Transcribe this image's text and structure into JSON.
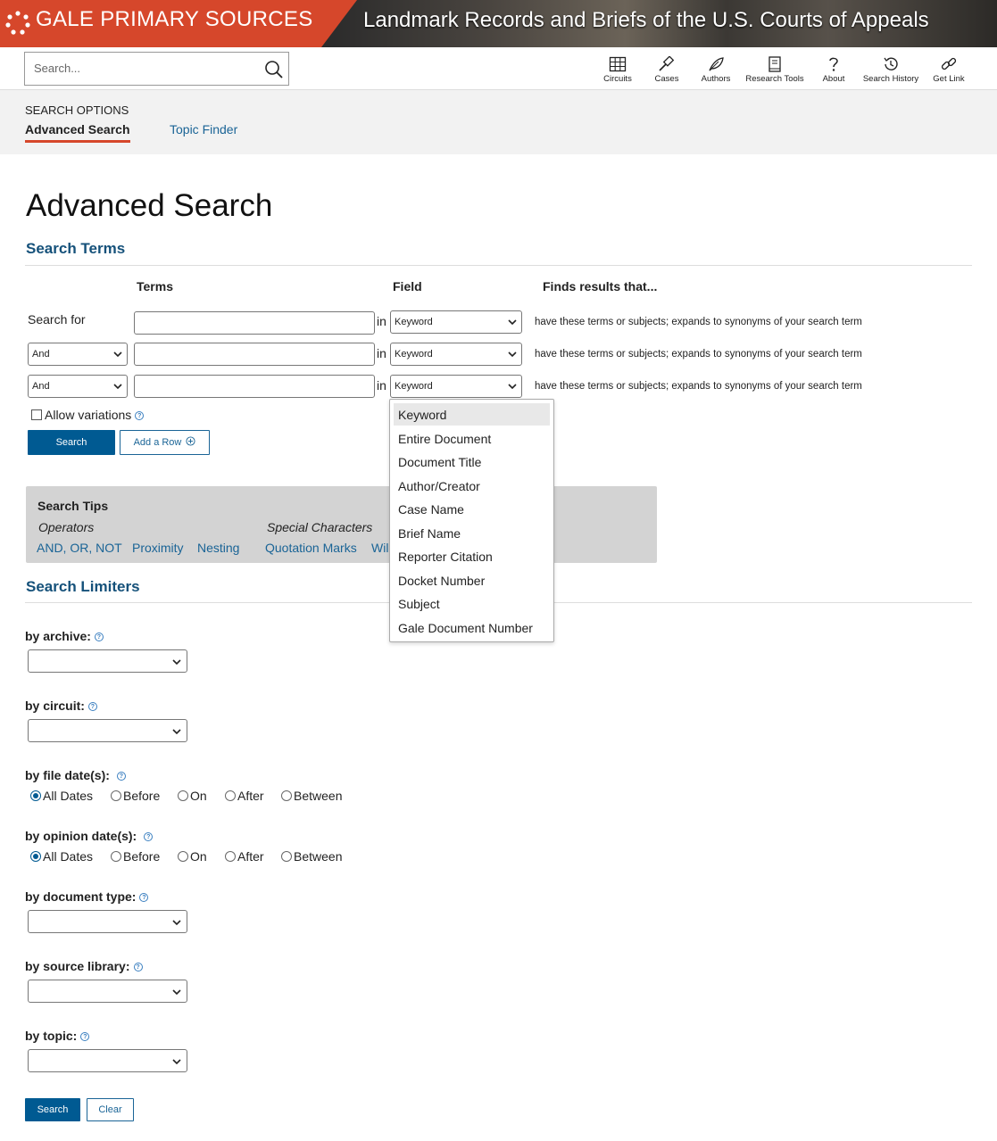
{
  "banner": {
    "brand": "GALE PRIMARY SOURCES",
    "collection": "Landmark Records and Briefs of the U.S. Courts of Appeals"
  },
  "toolbar": {
    "search_placeholder": "Search...",
    "tools": [
      {
        "label": "Circuits",
        "icon": "grid-icon"
      },
      {
        "label": "Cases",
        "icon": "gavel-icon"
      },
      {
        "label": "Authors",
        "icon": "feather-icon"
      },
      {
        "label": "Research Tools",
        "icon": "book-icon"
      },
      {
        "label": "About",
        "icon": "question-icon"
      },
      {
        "label": "Search History",
        "icon": "history-icon"
      },
      {
        "label": "Get Link",
        "icon": "link-icon"
      }
    ]
  },
  "options": {
    "label": "SEARCH OPTIONS",
    "advanced": "Advanced Search",
    "topic_finder": "Topic Finder"
  },
  "page": {
    "title": "Advanced Search",
    "search_terms_heading": "Search Terms",
    "search_limiters_heading": "Search Limiters"
  },
  "terms": {
    "col_terms": "Terms",
    "col_field": "Field",
    "col_finds": "Finds results that...",
    "first_label": "Search for",
    "in_word": "in",
    "rows": [
      {
        "operator": "",
        "field": "Keyword",
        "finds": "have these terms or subjects; expands to synonyms of your search term"
      },
      {
        "operator": "And",
        "field": "Keyword",
        "finds": "have these terms or subjects; expands to synonyms of your search term"
      },
      {
        "operator": "And",
        "field": "Keyword",
        "finds": "have these terms or subjects; expands to synonyms of your search term"
      }
    ],
    "allow_variations": "Allow variations",
    "search_button": "Search",
    "add_row_button": "Add a Row"
  },
  "field_dropdown": {
    "options": [
      "Keyword",
      "Entire Document",
      "Document Title",
      "Author/Creator",
      "Case Name",
      "Brief Name",
      "Reporter Citation",
      "Docket Number",
      "Subject",
      "Gale Document Number"
    ],
    "highlighted": "Keyword"
  },
  "tips": {
    "title": "Search Tips",
    "operators_label": "Operators",
    "special_label": "Special Characters",
    "links": [
      "AND, OR, NOT",
      "Proximity",
      "Nesting",
      "Quotation Marks",
      "Wil"
    ]
  },
  "limiters": {
    "archive": "by archive:",
    "circuit": "by circuit:",
    "file_date": "by file date(s):",
    "opinion_date": "by opinion date(s):",
    "document_type": "by document type:",
    "source_library": "by source library:",
    "topic": "by topic:",
    "date_options": [
      "All Dates",
      "Before",
      "On",
      "After",
      "Between"
    ],
    "file_date_selected": "All Dates",
    "opinion_date_selected": "All Dates",
    "search_button": "Search",
    "clear_button": "Clear"
  },
  "colors": {
    "brand_red": "#d6472b",
    "primary_blue": "#005a92",
    "heading_blue": "#15517a",
    "link_blue": "#1a6496"
  }
}
